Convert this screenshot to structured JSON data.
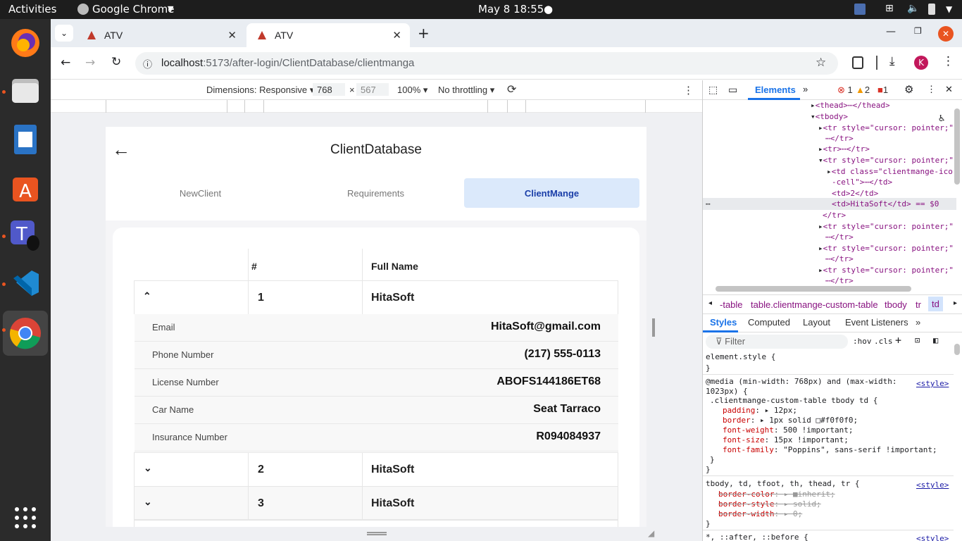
{
  "topbar": {
    "activities": "Activities",
    "app": "Google Chrome",
    "clock": "May 8  18:55"
  },
  "chrome": {
    "tabs": [
      {
        "title": "ATV"
      },
      {
        "title": "ATV"
      }
    ],
    "url_host": "localhost",
    "url_path": ":5173/after-login/ClientDatabase/clientmanga",
    "profile_initial": "K"
  },
  "devicebar": {
    "dimensions": "Dimensions: Responsive",
    "width": "768",
    "height": "567",
    "zoom": "100%",
    "throttle": "No throttling"
  },
  "page": {
    "title": "ClientDatabase",
    "tabs": [
      {
        "label": "NewClient"
      },
      {
        "label": "Requirements"
      },
      {
        "label": "ClientMange"
      }
    ],
    "table": {
      "headers": [
        "",
        "#",
        "Full Name"
      ],
      "rows": [
        {
          "num": "1",
          "name": "HitaSoft"
        },
        {
          "num": "2",
          "name": "HitaSoft"
        },
        {
          "num": "3",
          "name": "HitaSoft"
        }
      ],
      "details": [
        {
          "label": "Email",
          "value": "HitaSoft@gmail.com"
        },
        {
          "label": "Phone Number",
          "value": "(217) 555-0113"
        },
        {
          "label": "License Number",
          "value": "ABOFS144186ET68"
        },
        {
          "label": "Car Name",
          "value": "Seat Tarraco"
        },
        {
          "label": "Insurance Number",
          "value": "R094084937"
        }
      ]
    }
  },
  "devtools": {
    "tabs": [
      "Elements"
    ],
    "errors": "1",
    "warnings": "2",
    "issues": "1",
    "dom_lines": [
      "<thead>⋯</thead>",
      "<tbody>",
      "<tr style=\"cursor: pointer;\"",
      "⋯</tr>",
      "<tr>⋯</tr>",
      "<tr style=\"cursor: pointer;\"",
      "<td class=\"clientmange-ico",
      "-cell\">⋯</td>",
      "<td>2</td>",
      "<td>HitaSoft</td> == $0",
      "</tr>",
      "<tr style=\"cursor: pointer;\"",
      "⋯</tr>",
      "<tr style=\"cursor: pointer;\"",
      "⋯</tr>",
      "<tr style=\"cursor: pointer;\"",
      "⋯</tr>"
    ],
    "crumbs": [
      "-table",
      "table.clientmange-custom-table",
      "tbody",
      "tr",
      "td"
    ],
    "style_tabs": [
      "Styles",
      "Computed",
      "Layout",
      "Event Listeners"
    ],
    "filter_placeholder": "Filter",
    "hov": ":hov",
    "cls": ".cls",
    "styles": {
      "element_style": "element.style {",
      "close": "}",
      "media": "@media (min-width: 768px) and (max-width:",
      "media2": "1023px) {",
      "selector1": ".clientmange-custom-table tbody td {",
      "source": "<style>",
      "decls1": [
        {
          "p": "padding",
          "v": "▸ 12px;"
        },
        {
          "p": "border",
          "v": "▸ 1px solid □#f0f0f0;"
        },
        {
          "p": "font-weight",
          "v": "500 !important;"
        },
        {
          "p": "font-size",
          "v": "15px !important;"
        },
        {
          "p": "font-family",
          "v": "\"Poppins\", sans-serif !important;"
        }
      ],
      "selector2": "tbody, td, tfoot, th, thead, tr {",
      "decls2": [
        {
          "p": "border-color",
          "v": "▸ ■inherit;"
        },
        {
          "p": "border-style",
          "v": "▸ solid;"
        },
        {
          "p": "border-width",
          "v": "▸ 0;"
        }
      ],
      "selector3": "*, ::after, ::before {"
    }
  }
}
